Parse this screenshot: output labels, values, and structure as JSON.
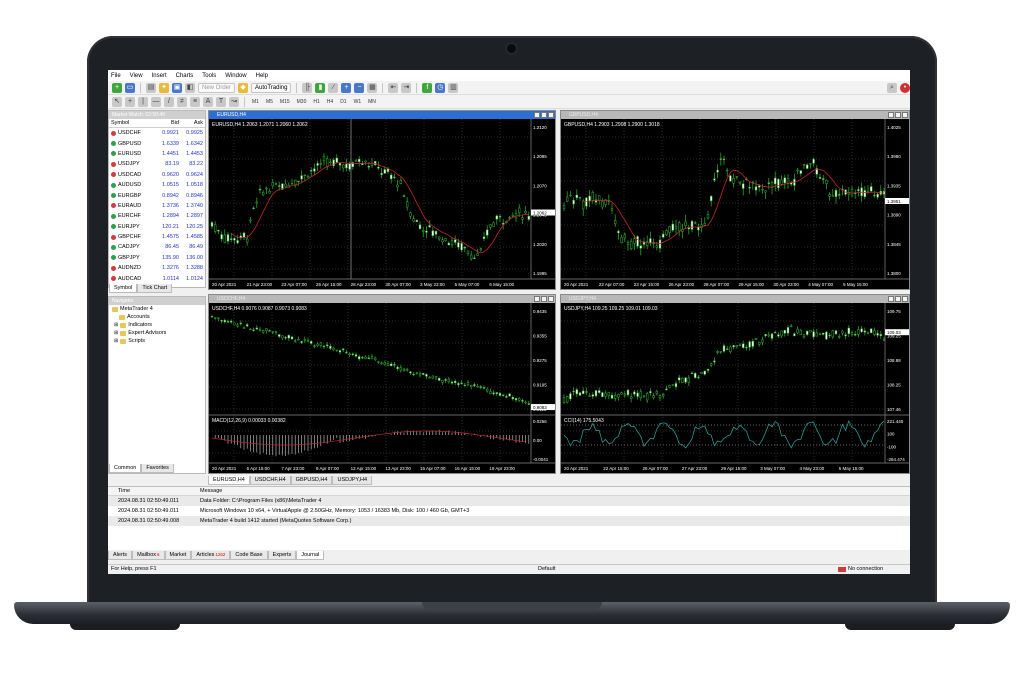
{
  "menu": [
    "File",
    "View",
    "Insert",
    "Charts",
    "Tools",
    "Window",
    "Help"
  ],
  "toolbar": {
    "new_order": "New Order",
    "autotrading": "AutoTrading",
    "timeframes": [
      "M1",
      "M5",
      "M15",
      "M30",
      "H1",
      "H4",
      "D1",
      "W1",
      "MN"
    ]
  },
  "market_watch": {
    "title": "Market Watch: 02:50:49",
    "headers": [
      "Symbol",
      "Bid",
      "Ask"
    ],
    "rows": [
      {
        "symbol": "USDCHF",
        "bid": "0.9921",
        "ask": "0.9925",
        "dir": "dn"
      },
      {
        "symbol": "GBPUSD",
        "bid": "1.6339",
        "ask": "1.6342",
        "dir": "up"
      },
      {
        "symbol": "EURUSD",
        "bid": "1.4451",
        "ask": "1.4453",
        "dir": "up"
      },
      {
        "symbol": "USDJPY",
        "bid": "83.19",
        "ask": "83.22",
        "dir": "dn"
      },
      {
        "symbol": "USDCAD",
        "bid": "0.9620",
        "ask": "0.9624",
        "dir": "dn"
      },
      {
        "symbol": "AUDUSD",
        "bid": "1.0515",
        "ask": "1.0518",
        "dir": "up"
      },
      {
        "symbol": "EURGBP",
        "bid": "0.8942",
        "ask": "0.8946",
        "dir": "up"
      },
      {
        "symbol": "EURAUD",
        "bid": "1.3736",
        "ask": "1.3740",
        "dir": "dn"
      },
      {
        "symbol": "EURCHF",
        "bid": "1.2894",
        "ask": "1.2897",
        "dir": "up"
      },
      {
        "symbol": "EURJPY",
        "bid": "120.21",
        "ask": "120.25",
        "dir": "up"
      },
      {
        "symbol": "GBPCHF",
        "bid": "1.4575",
        "ask": "1.4585",
        "dir": "dn"
      },
      {
        "symbol": "CADJPY",
        "bid": "86.45",
        "ask": "86.49",
        "dir": "up"
      },
      {
        "symbol": "GBPJPY",
        "bid": "135.90",
        "ask": "136.00",
        "dir": "up"
      },
      {
        "symbol": "AUDNZD",
        "bid": "1.3276",
        "ask": "1.3288",
        "dir": "dn"
      },
      {
        "symbol": "AUDCAD",
        "bid": "1.0114",
        "ask": "1.0124",
        "dir": "dn"
      }
    ],
    "tabs": [
      "Symbol",
      "Tick Chart"
    ]
  },
  "navigator": {
    "title": "Navigator",
    "root": "MetaTrader 4",
    "items": [
      "Accounts",
      "Indicators",
      "Expert Advisors",
      "Scripts"
    ],
    "tabs": [
      "Common",
      "Favorites"
    ]
  },
  "charts": [
    {
      "title": "EURUSD,H4",
      "info": "EURUSD,H4 1.2063 1.2071 1.2060 1.2062",
      "xlabels": [
        "20 Apr 2021",
        "21 Apr 23:00",
        "23 Apr 07:00",
        "26 Apr 15:00",
        "28 Apr 23:00",
        "30 Apr 07:00",
        "3 May 23:00",
        "5 May 07:00",
        "6 May 15:00"
      ],
      "ylabels": [
        "1.2120",
        "1.2095",
        "1.2070",
        "1.2045",
        "1.2020",
        "1.1995"
      ],
      "price": "1.2062"
    },
    {
      "title": "GBPUSD,H4",
      "info": "GBPUSD,H4 1.2903 1.2908 1.2900 1.3018",
      "xlabels": [
        "20 Apr 2021",
        "22 Apr 07:00",
        "23 Apr 15:00",
        "26 Apr 23:00",
        "28 Apr 07:00",
        "29 Apr 15:00",
        "30 Apr 23:00",
        "4 May 07:00",
        "5 May 15:00"
      ],
      "ylabels": [
        "1.4025",
        "1.3980",
        "1.3935",
        "1.3890",
        "1.3845",
        "1.3800"
      ],
      "price": "1.3951"
    },
    {
      "title": "USDCHF,H4",
      "info": "USDCHF,H4 0.9076 0.9087 0.9073 0.9083",
      "macd": "MACD(12,26,9) 0.00033 0.00382",
      "xlabels": [
        "20 Apr 2021",
        "6 Apr 15:00",
        "7 Apr 23:00",
        "9 Apr 07:00",
        "12 Apr 15:00",
        "13 Apr 23:00",
        "15 Apr 07:00",
        "16 Apr 15:00",
        "19 Apr 23:00"
      ],
      "ylabels": [
        "0.9435",
        "0.9355",
        "0.9275",
        "0.9195",
        "0.9115"
      ],
      "price": "0.9083",
      "sublabels": [
        "0.0256",
        "0.00",
        "-0.0041"
      ]
    },
    {
      "title": "USDJPY,H4",
      "info": "USDJPY,H4 109.25 109.25 109.01 109.03",
      "cci": "CCI(14) 175.5043",
      "xlabels": [
        "20 Apr 2021",
        "22 Apr 15:00",
        "26 Apr 07:00",
        "27 Apr 23:00",
        "29 Apr 15:00",
        "3 May 07:00",
        "4 May 23:00",
        "6 May 15:00"
      ],
      "ylabels": [
        "109.75",
        "109.25",
        "108.88",
        "108.25",
        "107.46"
      ],
      "price": "109.03",
      "sublabels": [
        "221.440",
        "100",
        "-100",
        "-264.474"
      ]
    }
  ],
  "chart_tabs": [
    "EURUSD,H4",
    "USDCHF,H4",
    "GBPUSD,H4",
    "USDJPY,H4"
  ],
  "terminal": {
    "headers": [
      "Time",
      "Message"
    ],
    "rows": [
      {
        "time": "2024.08.31 02:50:49.011",
        "message": "Data Folder: C:\\Program Files (x86)\\MetaTrader 4"
      },
      {
        "time": "2024.08.31 02:50:49.011",
        "message": "Microsoft Windows 10 x64, + VirtualApple @ 2.50GHz, Memory: 1053 / 16383 Mb, Disk: 100 / 460 Gb, GMT+3"
      },
      {
        "time": "2024.08.31 02:50:49.008",
        "message": "MetaTrader 4 build 1412 started (MetaQuotes Software Corp.)"
      }
    ],
    "tabs": [
      "Alerts",
      "Mailbox",
      "Market",
      "Articles",
      "Code Base",
      "Experts",
      "Journal"
    ],
    "badges": {
      "mailbox": "6",
      "articles": "1262"
    }
  },
  "status": {
    "help": "For Help, press F1",
    "profile": "Default",
    "connection": "No connection"
  }
}
